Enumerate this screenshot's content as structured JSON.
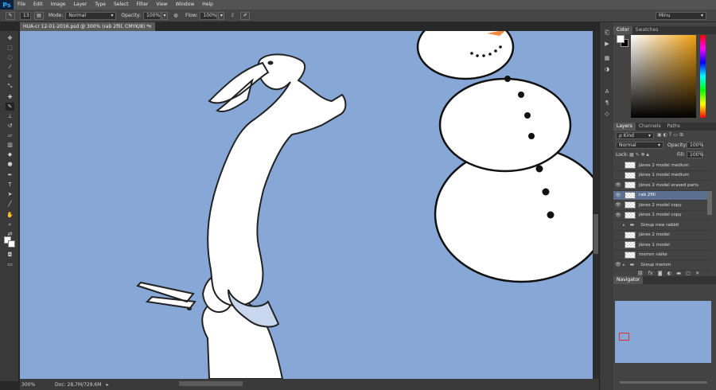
{
  "menubar": {
    "logo": "Ps",
    "items": [
      "File",
      "Edit",
      "Image",
      "Layer",
      "Type",
      "Select",
      "Filter",
      "View",
      "Window",
      "Help"
    ]
  },
  "options": {
    "brush_size": "13",
    "mode_label": "Mode:",
    "mode_value": "Normal",
    "opacity_label": "Opacity:",
    "opacity_value": "100%",
    "flow_label": "Flow:",
    "flow_value": "100%",
    "workspace": "Minu"
  },
  "document": {
    "tab_title": "HUA-cr 12-01-2016.psd @ 300% (rab 2fill, CMYK/8) *",
    "close": "×"
  },
  "status": {
    "zoom": "300%",
    "doc_size": "Doc: 28,7M/729,6M"
  },
  "panels": {
    "color_tabs": [
      "Color",
      "Swatches"
    ],
    "layers_tabs": [
      "Layers",
      "Channels",
      "Paths"
    ],
    "kind": "ρ Kind",
    "blend": "Normal",
    "opacity_label": "Opacity:",
    "opacity": "100%",
    "lock_label": "Lock:",
    "fill_label": "Fill:",
    "fill": "100%",
    "layers": [
      {
        "name": "jänes 2 model medium",
        "visible": false,
        "type": "layer",
        "selected": false
      },
      {
        "name": "jänes 1 model medium",
        "visible": false,
        "type": "layer",
        "selected": false
      },
      {
        "name": "jänes 2 model erased parts",
        "visible": true,
        "type": "layer",
        "selected": false
      },
      {
        "name": "rab 2fill",
        "visible": true,
        "type": "layer",
        "selected": true
      },
      {
        "name": "jänes 2 model copy",
        "visible": true,
        "type": "layer",
        "selected": false
      },
      {
        "name": "jänes 1 model copy",
        "visible": true,
        "type": "layer",
        "selected": false
      },
      {
        "name": "Group new rabbit",
        "visible": false,
        "type": "group",
        "selected": false
      },
      {
        "name": "jänes 2 model",
        "visible": false,
        "type": "layer",
        "selected": false
      },
      {
        "name": "jänes 1 model",
        "visible": false,
        "type": "layer",
        "selected": false
      },
      {
        "name": "memm väike",
        "visible": false,
        "type": "layer",
        "selected": false
      },
      {
        "name": "Group memm",
        "visible": true,
        "type": "group",
        "selected": false
      }
    ],
    "navigator_tab": "Navigator"
  },
  "colors": {
    "canvas": "#87a7d7",
    "ui_dark": "#282828",
    "selected_layer": "#5b6f8e"
  }
}
